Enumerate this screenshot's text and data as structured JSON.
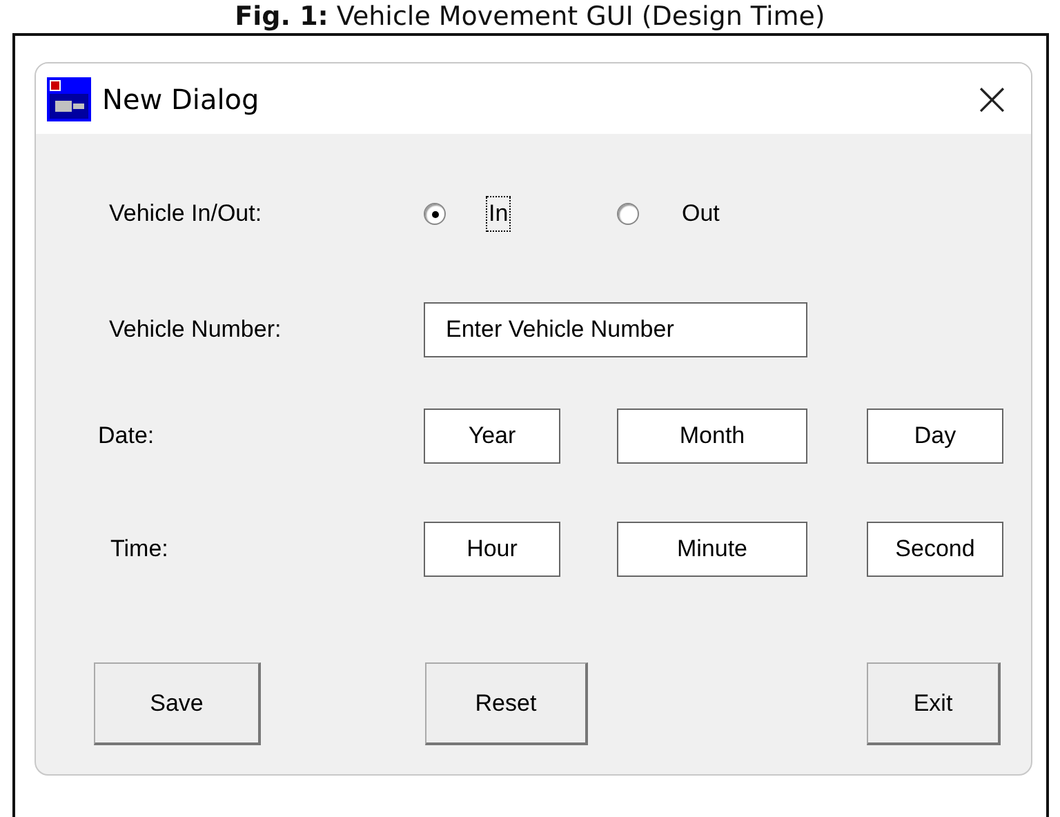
{
  "caption": "**Fig. 1:** Vehicle Movement GUI (Design Time)",
  "window": {
    "title": "New Dialog",
    "close": "×"
  },
  "rows": [
    {
      "kind": "radio",
      "label": "Vehicle In/Out:",
      "options": [
        {
          "label": "In",
          "selected": true,
          "focused": true
        },
        {
          "label": "Out",
          "selected": false,
          "focused": false
        }
      ]
    },
    {
      "kind": "fields",
      "label": "Vehicle Number:",
      "fields": [
        {
          "value": "Enter Vehicle Number"
        }
      ]
    },
    {
      "kind": "fields",
      "label": "Date:",
      "fields": [
        {
          "value": "Year"
        },
        {
          "value": "Month"
        },
        {
          "value": "Day"
        }
      ]
    },
    {
      "kind": "fields",
      "label": "Time:",
      "fields": [
        {
          "value": "Hour"
        },
        {
          "value": "Minute"
        },
        {
          "value": "Second"
        }
      ]
    }
  ],
  "buttons": [
    "Save",
    "Reset",
    "Exit"
  ]
}
